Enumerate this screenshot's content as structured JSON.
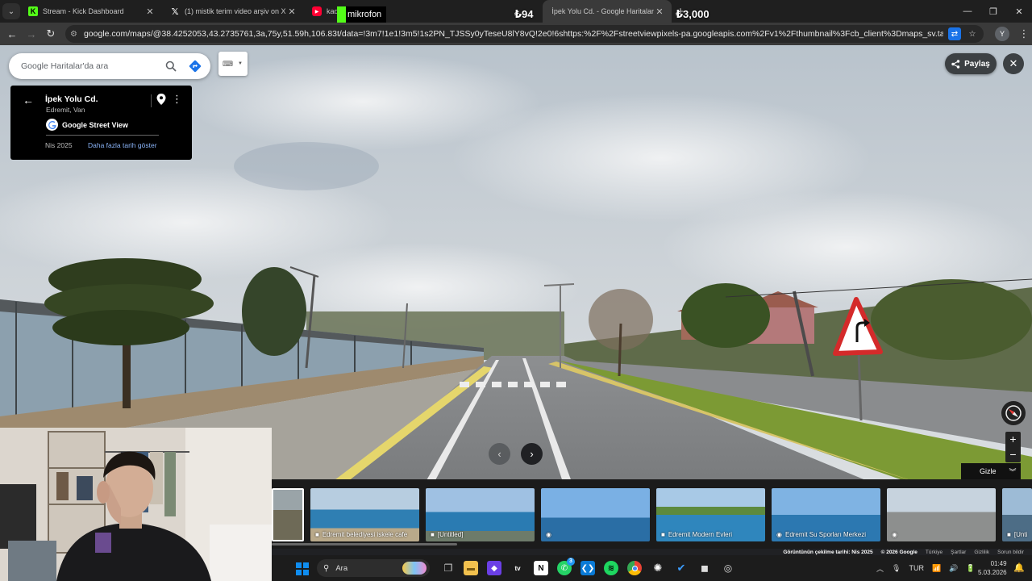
{
  "browser": {
    "tabs": [
      {
        "title": "Stream - Kick Dashboard",
        "icon": "kick-icon",
        "color": "#53fc18"
      },
      {
        "title": "(1) mistik terim video arşiv on X",
        "icon": "x-icon",
        "color": "#ffffff"
      },
      {
        "title": "kadın kuaförü",
        "icon": "youtube-icon",
        "color": "#ff0033"
      },
      {
        "title": "İpek Yolu Cd. - Google Haritalar",
        "icon": "google-maps-icon",
        "color": "#34a853"
      }
    ],
    "close_glyph": "✕",
    "new_tab_glyph": "+",
    "window_controls": {
      "minimize": "—",
      "maximize": "❐",
      "close": "✕"
    },
    "url": "google.com/maps/@38.4252053,43.2735761,3a,75y,51.59h,106.83t/data=!3m7!1e1!3m5!1s2PN_TJSSy0yTeseU8lY8vQ!2e0!6shttps:%2F%2Fstreetviewpixels-pa.googleapis.com%2Fv1%2Fthumbnail%3Fcb_client%3Dmaps_sv.tactile%26w%3D900%26h%3D600%2...",
    "profile_initial": "Y",
    "kebab": "⋮"
  },
  "overlay": {
    "mic_label": "mikrofon",
    "amount_small": "₺94",
    "amount_large": "₺3,000"
  },
  "maps": {
    "search_placeholder": "Google Haritalar'da ara",
    "place_title": "İpek Yolu Cd.",
    "place_subtitle": "Edremit, Van",
    "provider": "Google Street View",
    "capture_date": "Nis 2025",
    "more_dates": "Daha fazla tarih göster",
    "share_label": "Paylaş",
    "hide_label": "Gizle",
    "zoom_in": "+",
    "zoom_out": "−",
    "accent_color": "#1a73e8",
    "thumbnails": [
      {
        "label": ""
      },
      {
        "label": "Edremit belediyesi iskele cafe"
      },
      {
        "label": "[Untitled]"
      },
      {
        "label": ""
      },
      {
        "label": "Edremit Modern Evleri"
      },
      {
        "label": "Edremit Su Sporları Merkezi"
      },
      {
        "label": ""
      },
      {
        "label": "[Unti"
      }
    ],
    "attribution": {
      "capture": "Görüntünün çekilme tarihi: Nis 2025",
      "copyright": "© 2026 Google",
      "country": "Türkiye",
      "terms": "Şartlar",
      "privacy": "Gizlilik",
      "report": "Sorun bildir"
    }
  },
  "taskbar": {
    "search_label": "Ara",
    "language": "TUR",
    "time": "01:49",
    "date": "5.03.2026",
    "whatsapp_badge": "3"
  }
}
